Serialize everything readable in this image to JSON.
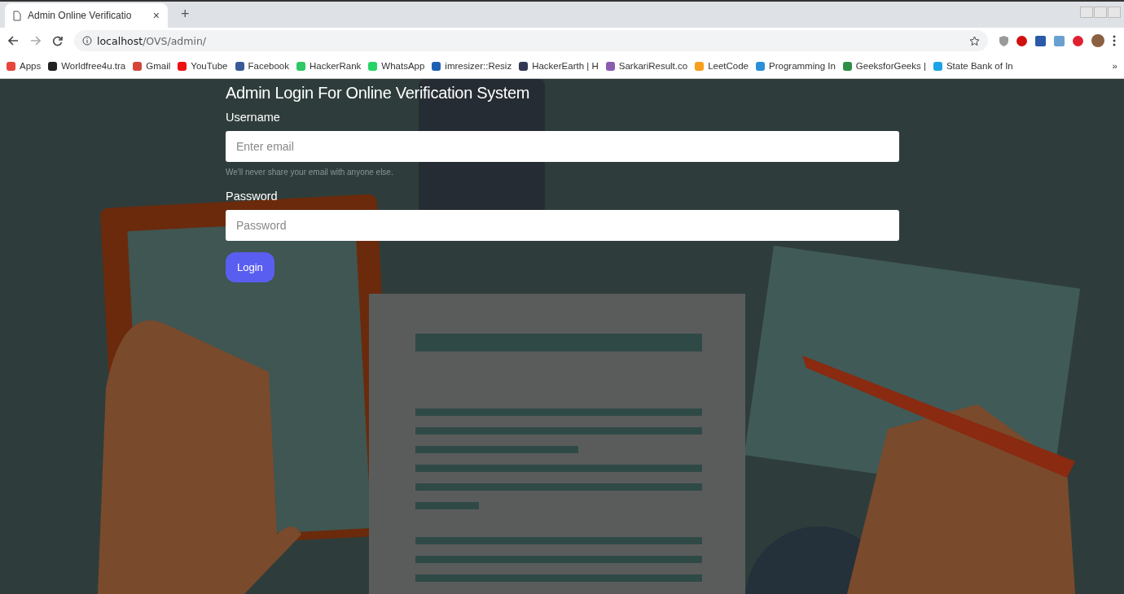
{
  "browser": {
    "tab": {
      "title": "Admin Online Verificatio",
      "close": "×",
      "selected": true
    },
    "new_tab": "+",
    "url_host": "localhost",
    "url_path": "/OVS/admin/",
    "bookmarks": [
      {
        "label": "Apps",
        "color": "#e8453c"
      },
      {
        "label": "Worldfree4u.tra",
        "color": "#222222"
      },
      {
        "label": "Gmail",
        "color": "#d44638"
      },
      {
        "label": "YouTube",
        "color": "#ee1111"
      },
      {
        "label": "Facebook",
        "color": "#3b5998"
      },
      {
        "label": "HackerRank",
        "color": "#2ec866"
      },
      {
        "label": "WhatsApp",
        "color": "#25d366"
      },
      {
        "label": "imresizer::Resiz",
        "color": "#1e5fb4"
      },
      {
        "label": "HackerEarth | H",
        "color": "#323754"
      },
      {
        "label": "SarkariResult.co",
        "color": "#8a5cb0"
      },
      {
        "label": "LeetCode",
        "color": "#f89f1b"
      },
      {
        "label": "Programming In",
        "color": "#2a8fd8"
      },
      {
        "label": "GeeksforGeeks |",
        "color": "#2f8d46"
      },
      {
        "label": "State Bank of In",
        "color": "#1aa3e6"
      }
    ],
    "more": "»"
  },
  "login": {
    "title": "Admin Login For Online Verification System",
    "fields": [
      {
        "label": "Username",
        "placeholder": "Enter email",
        "help": "We'll never share your email with anyone else."
      },
      {
        "label": "Password",
        "placeholder": "Password"
      }
    ],
    "button": "Login"
  }
}
